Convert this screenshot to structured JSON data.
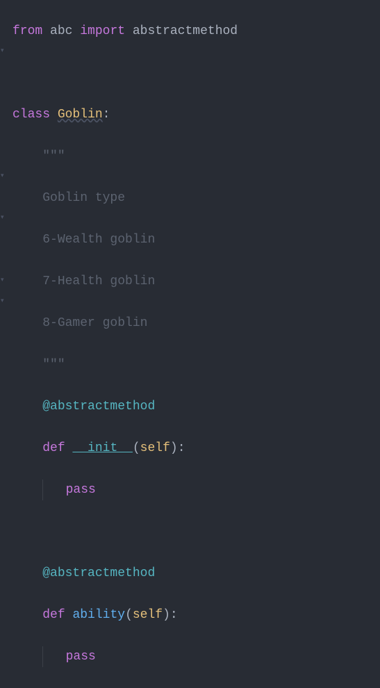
{
  "code": {
    "kw_from": "from",
    "mod_abc": "abc",
    "kw_import": "import",
    "sym_abstractmethod": "abstractmethod",
    "kw_class": "class",
    "classname": "Goblin",
    "colon": ":",
    "docq": "\"\"\"",
    "doc1": "Goblin type",
    "doc2": "6-Wealth goblin",
    "doc3": "7-Health goblin",
    "doc4": "8-Gamer goblin",
    "decorator": "@abstractmethod",
    "kw_def": "def",
    "func_init": "__init__",
    "func_ability": "ability",
    "lparen": "(",
    "self": "self",
    "rparen": ")",
    "kw_pass": "pass"
  },
  "fold": {
    "down": "▾",
    "right": "▸"
  }
}
